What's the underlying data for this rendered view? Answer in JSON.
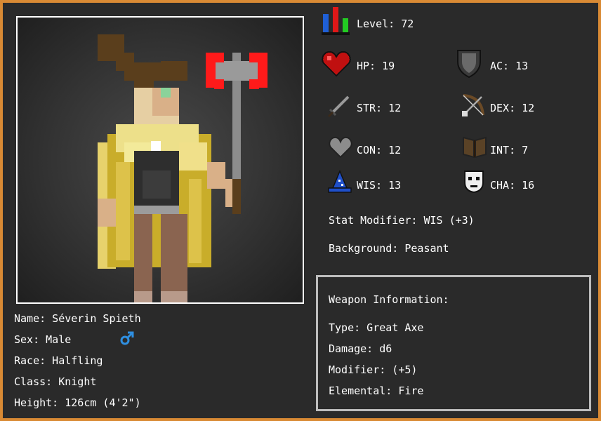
{
  "character": {
    "name_label": "Name: Séverin Spieth",
    "sex_label": "Sex: Male",
    "race_label": "Race: Halfling",
    "class_label": "Class: Knight",
    "height_label": "Height: 126cm (4'2\")"
  },
  "stats": {
    "level": "Level: 72",
    "hp": "HP: 19",
    "ac": "AC: 13",
    "str": "STR: 12",
    "dex": "DEX: 12",
    "con": "CON: 12",
    "int": "INT: 7",
    "wis": "WIS: 13",
    "cha": "CHA: 16",
    "stat_modifier": "Stat Modifier: WIS (+3)",
    "background": "Background: Peasant"
  },
  "weapon": {
    "header": "Weapon Information:",
    "type": "Type: Great Axe",
    "damage": "Damage: d6",
    "modifier": "Modifier: (+5)",
    "elemental": "Elemental: Fire"
  },
  "icons": {
    "level": "level-bars-icon",
    "hp": "heart-icon",
    "ac": "shield-icon",
    "str": "sword-icon",
    "dex": "bow-icon",
    "con": "stone-heart-icon",
    "int": "book-icon",
    "wis": "wizard-hat-icon",
    "cha": "mask-icon",
    "sex": "male-symbol-icon"
  },
  "colors": {
    "frame_border": "#d98a34",
    "background": "#2a2a2a",
    "text": "#ffffff",
    "weapon_box_border": "#bdbdbd",
    "male_symbol": "#2f8fe0"
  }
}
